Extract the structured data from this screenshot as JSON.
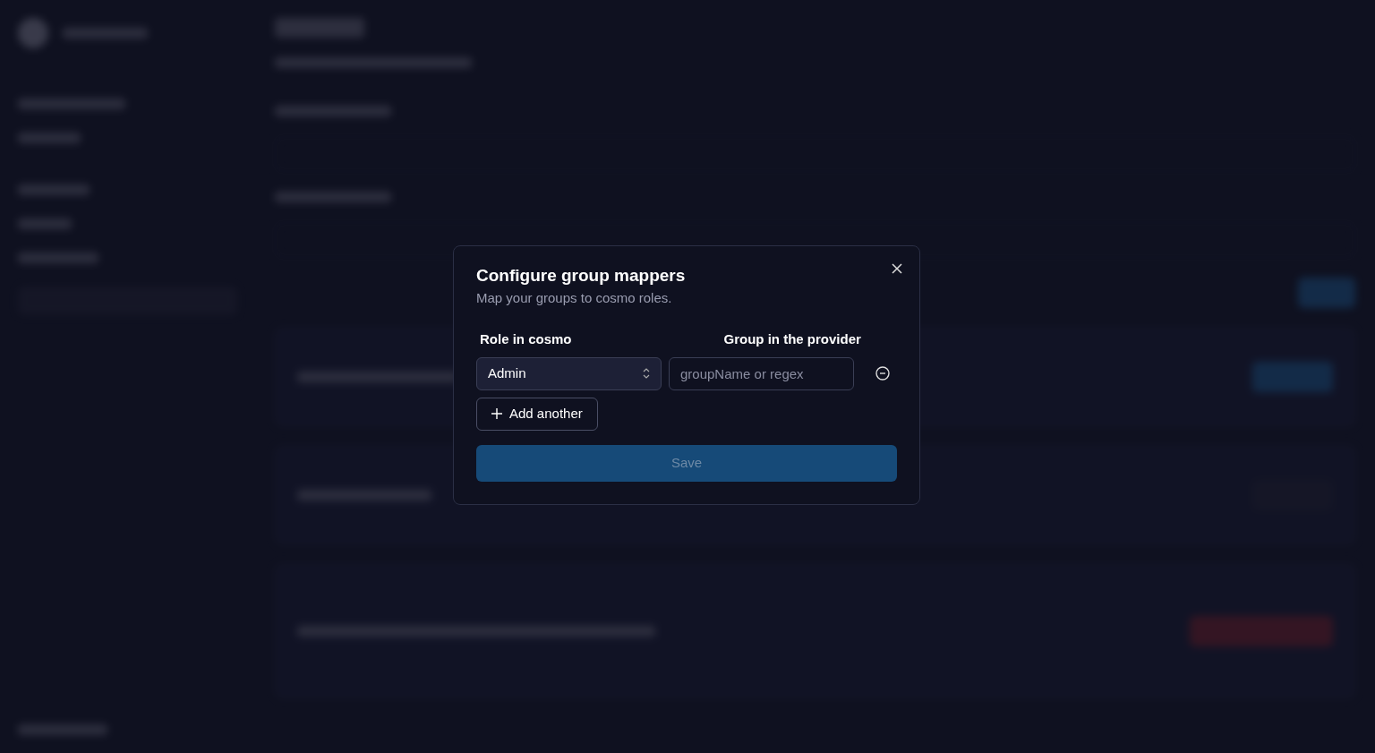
{
  "dialog": {
    "title": "Configure group mappers",
    "subtitle": "Map your groups to cosmo roles.",
    "columns": [
      "Role in cosmo",
      "Group in the provider"
    ],
    "rows": [
      {
        "role": "Admin",
        "group_placeholder": "groupName or regex"
      }
    ],
    "add_button": "Add another",
    "save_button": {
      "label": "Save",
      "disabled": true
    }
  }
}
